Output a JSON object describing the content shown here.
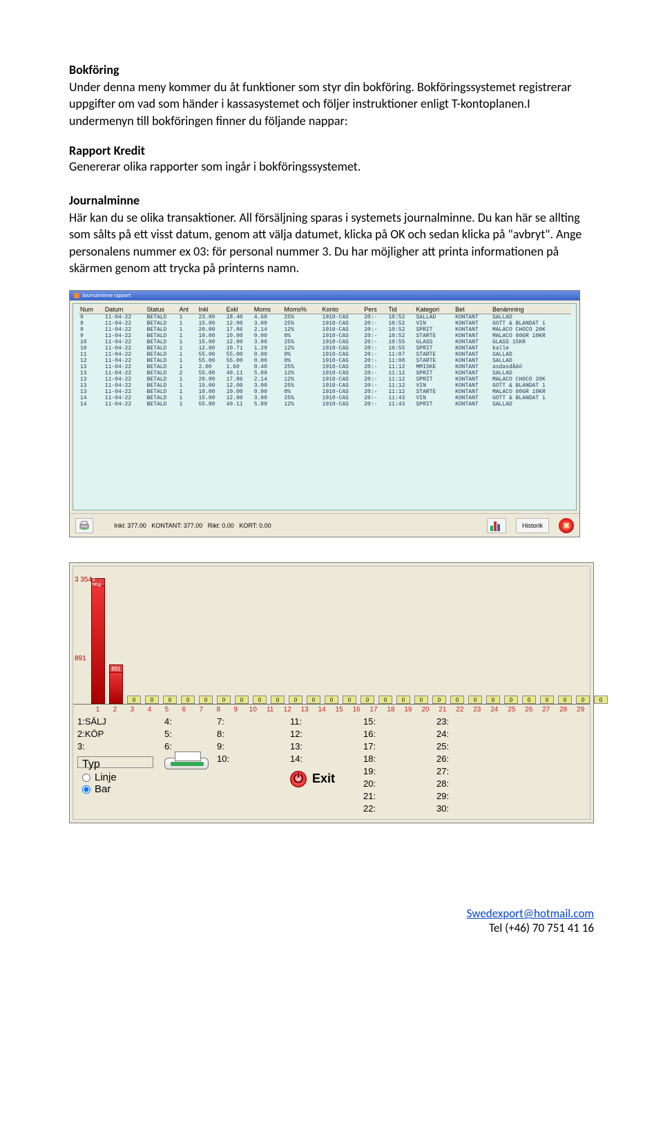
{
  "text": {
    "h1": "Bokföring",
    "p1": "Under denna meny kommer du åt funktioner som  styr   din bokföring. Bokföringssystemet  registrerar  uppgifter om vad som händer i kassasystemet och följer instruktioner enligt  T-kontoplanen.I undermenyn till bokföringen finner du följande nappar:",
    "rapport": "Rapport Kredit",
    "p2": "Genererar olika rapporter som ingår i bokföringssystemet.",
    "h2": "Journalminne",
    "p3": "Här kan du se olika transaktioner. All försäljning sparas i systemets journalminne. Du kan här se allting som sålts på ett visst datum, genom att välja datumet, klicka på OK och sedan klicka på \"avbryt\". Ange personalens nummer ex 03: för personal nummer 3. Du har möjligher att printa informationen på skärmen genom att trycka på printerns namn."
  },
  "window_title": "Journalminne rapport",
  "table": {
    "columns": [
      "Num",
      "Datum",
      "Status",
      "Ant",
      "Inkl",
      "Exkl",
      "Moms",
      "Moms%",
      "Konto",
      "Pers",
      "Tid",
      "Kategori",
      "Bet",
      "Benämning"
    ],
    "rows": [
      [
        "9",
        "11-04-22",
        "BETALD",
        "1",
        "23.00",
        "18.40",
        "4.60",
        "25%",
        "1910-CAS",
        "20:-",
        "10:52",
        "SALLAD",
        "KONTANT",
        "SALLAD"
      ],
      [
        "9",
        "11-04-22",
        "BETALD",
        "1",
        "15.00",
        "12.00",
        "3.00",
        "25%",
        "1910-CAS",
        "20:-",
        "10:52",
        "VIN",
        "KONTANT",
        "GOTT & BLANDAT 1"
      ],
      [
        "9",
        "11-04-22",
        "BETALD",
        "1",
        "20.00",
        "17.86",
        "2.14",
        "12%",
        "1910-CAS",
        "20:-",
        "10:52",
        "SPRIT",
        "KONTANT",
        "MALACO CHOCO 20K"
      ],
      [
        "9",
        "11-04-22",
        "BETALD",
        "1",
        "10.00",
        "10.00",
        "0.00",
        "0%",
        "1910-CAS",
        "20:-",
        "10:52",
        "STARTE",
        "KONTANT",
        "MALACO 80GR 10KR"
      ],
      [
        "10",
        "11-04-22",
        "BETALD",
        "1",
        "15.00",
        "12.00",
        "3.00",
        "25%",
        "1910-CAS",
        "20:-",
        "10:55",
        "GLASS",
        "KONTANT",
        "GLASS 15KR"
      ],
      [
        "10",
        "11-04-22",
        "BETALD",
        "1",
        "12.00",
        "10.71",
        "1.29",
        "12%",
        "1910-CAS",
        "20:-",
        "10:55",
        "SPRIT",
        "KONTANT",
        "kalle"
      ],
      [
        "11",
        "11-04-22",
        "BETALD",
        "1",
        "55.00",
        "55.00",
        "0.00",
        "0%",
        "1910-CAS",
        "20:-",
        "11:07",
        "STARTE",
        "KONTANT",
        "SALLAD"
      ],
      [
        "12",
        "11-04-22",
        "BETALD",
        "1",
        "55.00",
        "55.00",
        "0.00",
        "0%",
        "1910-CAS",
        "20:-",
        "11:08",
        "STARTE",
        "KONTANT",
        "SALLAD"
      ],
      [
        "13",
        "11-04-22",
        "BETALD",
        "1",
        "2.00",
        "1.60",
        "0.40",
        "25%",
        "1910-CAS",
        "20:-",
        "11:12",
        "MMISKE",
        "KONTANT",
        "asdasdåäö"
      ],
      [
        "13",
        "11-04-22",
        "BETALD",
        "2",
        "55.00",
        "49.11",
        "5.89",
        "12%",
        "1910-CAS",
        "20:-",
        "11:12",
        "SPRIT",
        "KONTANT",
        "SALLAD"
      ],
      [
        "13",
        "11-04-22",
        "BETALD",
        "1",
        "20.00",
        "17.86",
        "2.14",
        "12%",
        "1910-CAS",
        "20:-",
        "11:12",
        "SPRIT",
        "KONTANT",
        "MALACO CHOCO 20K"
      ],
      [
        "13",
        "11-04-22",
        "BETALD",
        "1",
        "15.00",
        "12.00",
        "3.00",
        "25%",
        "1910-CAS",
        "20:-",
        "11:12",
        "VIN",
        "KONTANT",
        "GOTT & BLANDAT 1"
      ],
      [
        "13",
        "11-04-22",
        "BETALD",
        "1",
        "10.00",
        "10.00",
        "0.00",
        "0%",
        "1910-CAS",
        "20:-",
        "11:12",
        "STARTE",
        "KONTANT",
        "MALACO 80GR 10KR"
      ],
      [
        "14",
        "11-04-22",
        "BETALD",
        "1",
        "15.00",
        "12.00",
        "3.00",
        "25%",
        "1910-CAS",
        "20:-",
        "11:43",
        "VIN",
        "KONTANT",
        "GOTT & BLANDAT 1"
      ],
      [
        "14",
        "11-04-22",
        "BETALD",
        "1",
        "55.00",
        "49.11",
        "5.89",
        "12%",
        "1910-CAS",
        "20:-",
        "11:43",
        "SPRIT",
        "KONTANT",
        "SALLAD"
      ]
    ]
  },
  "totals": {
    "inkl": "Inkl: 377.00",
    "kontant": "KONTANT: 377.00",
    "rikt": "Rikt: 0.00",
    "kort": "KORT: 0.00"
  },
  "historik_label": "Historik",
  "chart_data": {
    "type": "bar",
    "categories": [
      "1",
      "2",
      "3",
      "4",
      "5",
      "6",
      "7",
      "8",
      "9",
      "10",
      "11",
      "12",
      "13",
      "14",
      "15",
      "16",
      "17",
      "18",
      "19",
      "20",
      "21",
      "22",
      "23",
      "24",
      "25",
      "26",
      "27",
      "28",
      "29"
    ],
    "values": [
      3354,
      891,
      0,
      0,
      0,
      0,
      0,
      0,
      0,
      0,
      0,
      0,
      0,
      0,
      0,
      0,
      0,
      0,
      0,
      0,
      0,
      0,
      0,
      0,
      0,
      0,
      0,
      0,
      0
    ],
    "cap_labels": [
      "3 354",
      "891",
      "0",
      "0",
      "0",
      "0",
      "0",
      "0",
      "0",
      "0",
      "0",
      "0",
      "0",
      "0",
      "0",
      "0",
      "0",
      "0",
      "0",
      "0",
      "0",
      "0",
      "0",
      "0",
      "0",
      "0",
      "0",
      "0",
      "0"
    ],
    "title": "",
    "xlabel": "",
    "ylabel": "",
    "ylim": [
      0,
      3354
    ]
  },
  "legend_rows": {
    "c1": [
      "1:SÄLJ",
      "2:KÖP",
      "3:"
    ],
    "c2": [
      "4:",
      "5:",
      "6:"
    ],
    "c3": [
      "7:",
      "8:",
      "9:",
      "10:"
    ],
    "c4": [
      "11:",
      "12:",
      "13:",
      "14:"
    ],
    "c5": [
      "15:",
      "16:",
      "17:",
      "18:",
      "19:",
      "20:",
      "21:",
      "22:"
    ],
    "c6": [
      "23:",
      "24:",
      "25:",
      "26:",
      "27:",
      "28:",
      "29:",
      "30:"
    ]
  },
  "typ": {
    "title": "Typ",
    "linje": "Linje",
    "bar": "Bar"
  },
  "exit_label": "Exit",
  "footer": {
    "email": "Swedexport@hotmail.com",
    "tel": "Tel   (+46) 70 751 41 16"
  }
}
